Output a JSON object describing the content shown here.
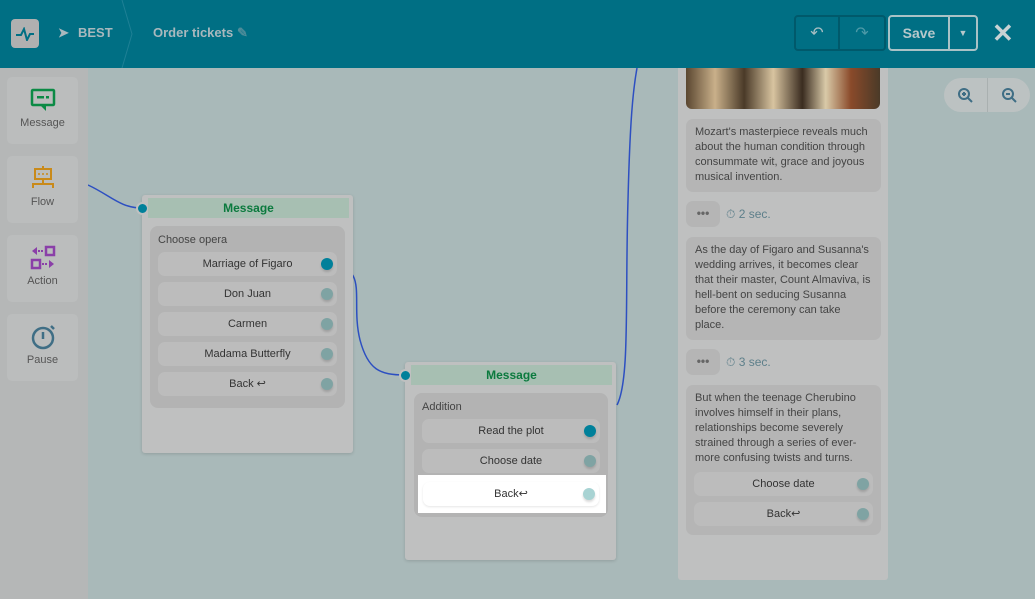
{
  "header": {
    "bot_name": "BEST",
    "flow_name": "Order tickets",
    "save_label": "Save"
  },
  "sidebar": {
    "items": [
      {
        "label": "Message",
        "icon": "message-icon",
        "color": "#0b8a45"
      },
      {
        "label": "Flow",
        "icon": "flow-icon",
        "color": "#c98a1a"
      },
      {
        "label": "Action",
        "icon": "action-icon",
        "color": "#8a3fa8"
      },
      {
        "label": "Pause",
        "icon": "stopwatch-icon",
        "color": "#3f6e85"
      }
    ]
  },
  "nodes": [
    {
      "title": "Message",
      "text": "Choose opera",
      "buttons": [
        "Marriage of Figaro",
        "Don Juan",
        "Carmen",
        "Madama Butterfly",
        "Back ↩"
      ]
    },
    {
      "title": "Message",
      "text": "Addition",
      "buttons": [
        "Read the plot",
        "Choose date",
        "Back↩"
      ]
    }
  ],
  "preview": {
    "messages": [
      "Mozart's masterpiece reveals much about the human condition through consummate wit, grace and joyous musical invention.",
      "As the day of Figaro and Susanna's wedding arrives, it becomes clear that their master, Count Almaviva, is hell-bent on seducing Susanna before the ceremony can take place.",
      "But when the teenage Cherubino involves himself in their plans, relationships become severely strained through a series of ever-more confusing twists and turns."
    ],
    "pauses": [
      "2 sec.",
      "3 sec."
    ],
    "dots": "•••",
    "buttons": [
      "Choose date",
      "Back↩"
    ]
  },
  "colors": {
    "header": "#006f84",
    "accent": "#00809a",
    "connector": "#2d4fc1",
    "node_title": "#0b7a3e"
  }
}
